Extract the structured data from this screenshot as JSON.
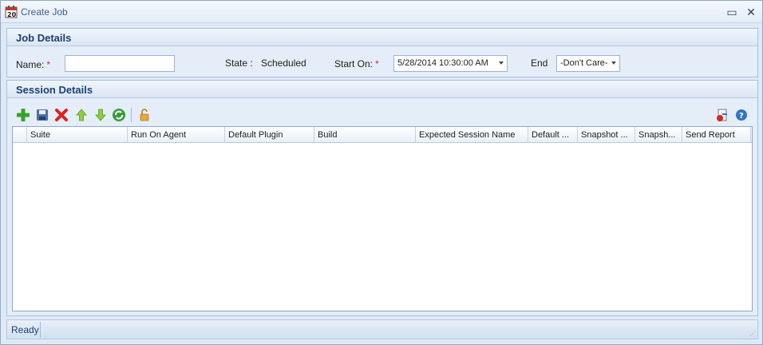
{
  "window": {
    "title": "Create Job",
    "icon": "calendar-icon",
    "restore_icon": "restore-icon",
    "close_icon": "close-icon"
  },
  "job_details": {
    "title": "Job Details",
    "name_label": "Name:",
    "name_value": "",
    "required_marker": "*",
    "state_label": "State :",
    "state_value": "Scheduled",
    "start_label": "Start On:",
    "start_value": "5/28/2014 10:30:00 AM",
    "end_label": "End",
    "end_value": "-Don't Care-"
  },
  "session_details": {
    "title": "Session Details",
    "toolbar": [
      "add-icon",
      "save-icon",
      "delete-icon",
      "move-up-icon",
      "move-down-icon",
      "refresh-icon",
      "unlock-icon",
      "export-icon",
      "help-icon"
    ],
    "columns": [
      "Suite",
      "Run On Agent",
      "Default Plugin",
      "Build",
      "Expected Session Name",
      "Default ...",
      "Snapshot ...",
      "Snapsh...",
      "Send Report"
    ],
    "rows": []
  },
  "status": {
    "text": "Ready"
  },
  "colors": {
    "accent": "#1e3f71",
    "required": "#e0242a",
    "add": "#3aa22a",
    "delete": "#d9241f"
  }
}
